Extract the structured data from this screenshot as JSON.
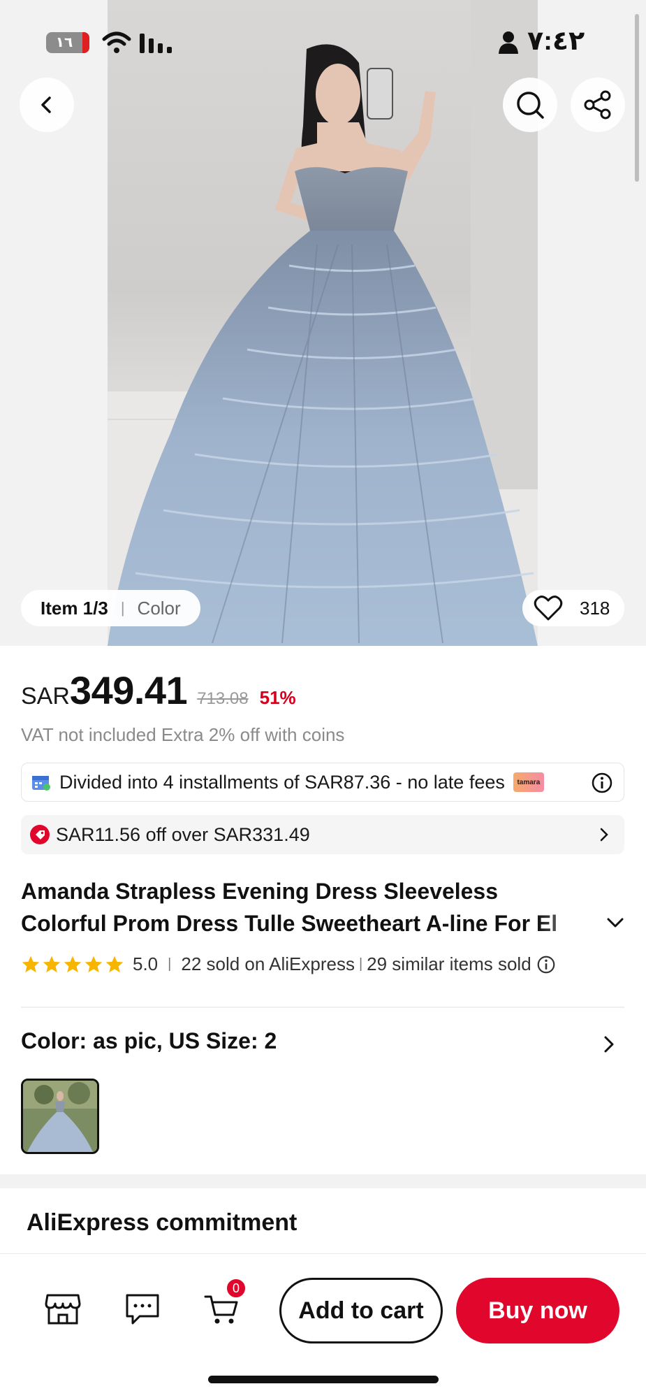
{
  "status_bar": {
    "battery": "١٦",
    "time": "٧:٤٢"
  },
  "gallery": {
    "item_counter": "Item 1/3",
    "variant_label": "Color",
    "likes": "318"
  },
  "price": {
    "currency": "SAR",
    "current": "349.41",
    "original": "713.08",
    "discount": "51%"
  },
  "vat_note": "VAT not included Extra 2% off with coins",
  "installments": {
    "text": "Divided into 4 installments of SAR87.36  - no late fees",
    "provider": "tamara"
  },
  "coupon": {
    "text": "SAR11.56 off over SAR331.49"
  },
  "product": {
    "title_line1": "Amanda Strapless Evening Dress Sleeveless",
    "title_line2": "Colorful Prom Dress Tulle Sweetheart A-line For El",
    "rating": "5.0",
    "sold": "22 sold on AliExpress",
    "similar_sold": "29 similar items sold"
  },
  "variant": {
    "selection": "Color: as pic, US Size: 2"
  },
  "commitment_title": "AliExpress commitment",
  "bottom_bar": {
    "cart_count": "0",
    "add_to_cart": "Add to cart",
    "buy_now": "Buy now"
  },
  "colors": {
    "accent_red": "#e1062c",
    "discount_red": "#d6001c",
    "star_yellow": "#f7b500"
  }
}
